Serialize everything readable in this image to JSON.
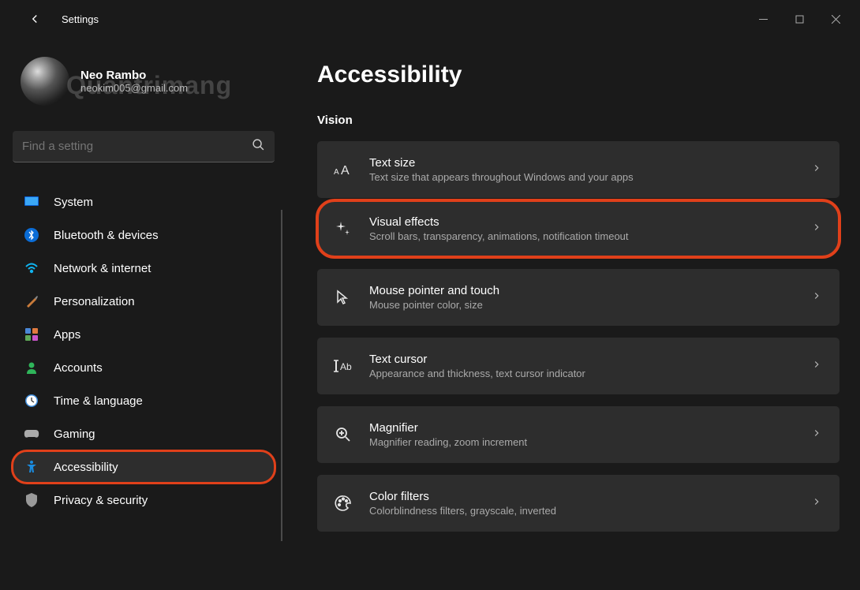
{
  "window": {
    "title": "Settings"
  },
  "user": {
    "name": "Neo Rambo",
    "email": "neokim005@gmail.com"
  },
  "watermark": "Quantrimang",
  "search": {
    "placeholder": "Find a setting"
  },
  "nav": {
    "items": [
      {
        "label": "System"
      },
      {
        "label": "Bluetooth & devices"
      },
      {
        "label": "Network & internet"
      },
      {
        "label": "Personalization"
      },
      {
        "label": "Apps"
      },
      {
        "label": "Accounts"
      },
      {
        "label": "Time & language"
      },
      {
        "label": "Gaming"
      },
      {
        "label": "Accessibility"
      },
      {
        "label": "Privacy & security"
      }
    ]
  },
  "page": {
    "heading": "Accessibility",
    "section": "Vision",
    "cards": [
      {
        "title": "Text size",
        "sub": "Text size that appears throughout Windows and your apps"
      },
      {
        "title": "Visual effects",
        "sub": "Scroll bars, transparency, animations, notification timeout"
      },
      {
        "title": "Mouse pointer and touch",
        "sub": "Mouse pointer color, size"
      },
      {
        "title": "Text cursor",
        "sub": "Appearance and thickness, text cursor indicator"
      },
      {
        "title": "Magnifier",
        "sub": "Magnifier reading, zoom increment"
      },
      {
        "title": "Color filters",
        "sub": "Colorblindness filters, grayscale, inverted"
      }
    ]
  },
  "highlights": {
    "nav_index": 8,
    "card_index": 1
  }
}
